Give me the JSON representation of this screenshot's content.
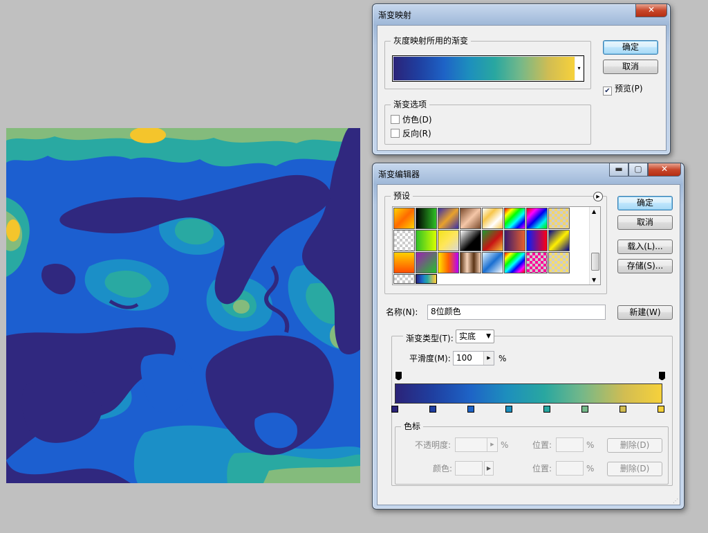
{
  "colors": {
    "gradient_start": "#2b2378",
    "gradient_end": "#f6d13b",
    "map_dark": "#30287f",
    "map_blue": "#1c5fd0",
    "map_mid": "#1b8fc7",
    "map_teal": "#29a9a2",
    "map_green": "#84bb7c",
    "map_yellow": "#f4c52c"
  },
  "gradient_map": {
    "title": "渐变映射",
    "group_gray": "灰度映射所用的渐变",
    "ok": "确定",
    "cancel": "取消",
    "preview": "预览(P)",
    "preview_checked": true,
    "group_options": "渐变选项",
    "dither": "仿色(D)",
    "dither_checked": false,
    "reverse": "反向(R)",
    "reverse_checked": false,
    "dropdown_icon": "arrow-down-icon",
    "close_icon": "close-icon"
  },
  "gradient_editor": {
    "title": "渐变编辑器",
    "presets_label": "预设",
    "ok": "确定",
    "cancel": "取消",
    "load": "载入(L)...",
    "save": "存储(S)...",
    "name_label": "名称(N):",
    "name_value": "8位颜色",
    "new_button": "新建(W)",
    "type_label": "渐变类型(T):",
    "type_value": "实底",
    "smooth_label": "平滑度(M):",
    "smooth_value": "100",
    "percent": "%",
    "stops_group": "色标",
    "opacity_label": "不透明度:",
    "opacity_pct": "%",
    "location_label": "位置:",
    "location_pct": "%",
    "delete_button": "删除(D)",
    "color_label": "颜色:",
    "color_location_label": "位置:",
    "color_location_pct": "%",
    "color_delete_button": "删除(D)",
    "minimize_icon": "minimize-icon",
    "maximize_icon": "maximize-icon",
    "close_icon": "close-icon",
    "color_stops": [
      "#2b2378",
      "#1f3fa0",
      "#1e63c6",
      "#1d8fbd",
      "#29a7a0",
      "#74b889",
      "#d2bd52",
      "#f6d13b"
    ]
  }
}
